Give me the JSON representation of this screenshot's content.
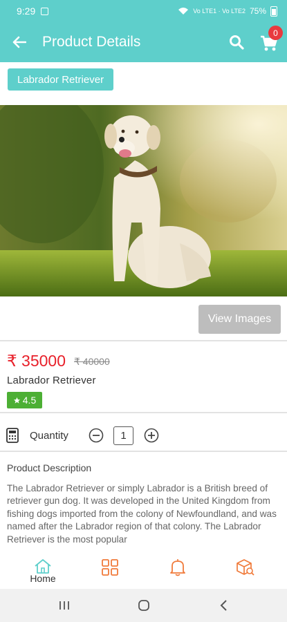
{
  "status_bar": {
    "time": "9:29",
    "network": "Vo LTE1 · Vo LTE2",
    "battery": "75%"
  },
  "app_bar": {
    "title": "Product Details",
    "cart_count": "0"
  },
  "breed_tag": "Labrador Retriever",
  "hero": {
    "image": "dog-photo"
  },
  "view_images_label": "View Images",
  "product": {
    "price": "₹ 35000",
    "original_price": "₹ 40000",
    "name": "Labrador Retriever",
    "rating": "4.5"
  },
  "quantity": {
    "label": "Quantity",
    "value": "1"
  },
  "description": {
    "title": "Product Description",
    "text": "The Labrador Retriever or simply Labrador is a British breed of retriever gun dog. It was developed in the United Kingdom from fishing dogs imported from the colony of Newfoundland, and was named after the Labrador region of that colony. The Labrador Retriever is the most popular"
  },
  "bottom_nav": {
    "items": [
      {
        "label": "Home",
        "icon": "home-icon",
        "active": true
      },
      {
        "label": "",
        "icon": "categories-icon",
        "active": false
      },
      {
        "label": "",
        "icon": "bell-icon",
        "active": false
      },
      {
        "label": "",
        "icon": "orders-icon",
        "active": false
      }
    ]
  },
  "colors": {
    "primary": "#5ecfcb",
    "accent": "#f07a3a",
    "price": "#e8202a",
    "rating": "#4caf34",
    "badge": "#e83a3f"
  }
}
